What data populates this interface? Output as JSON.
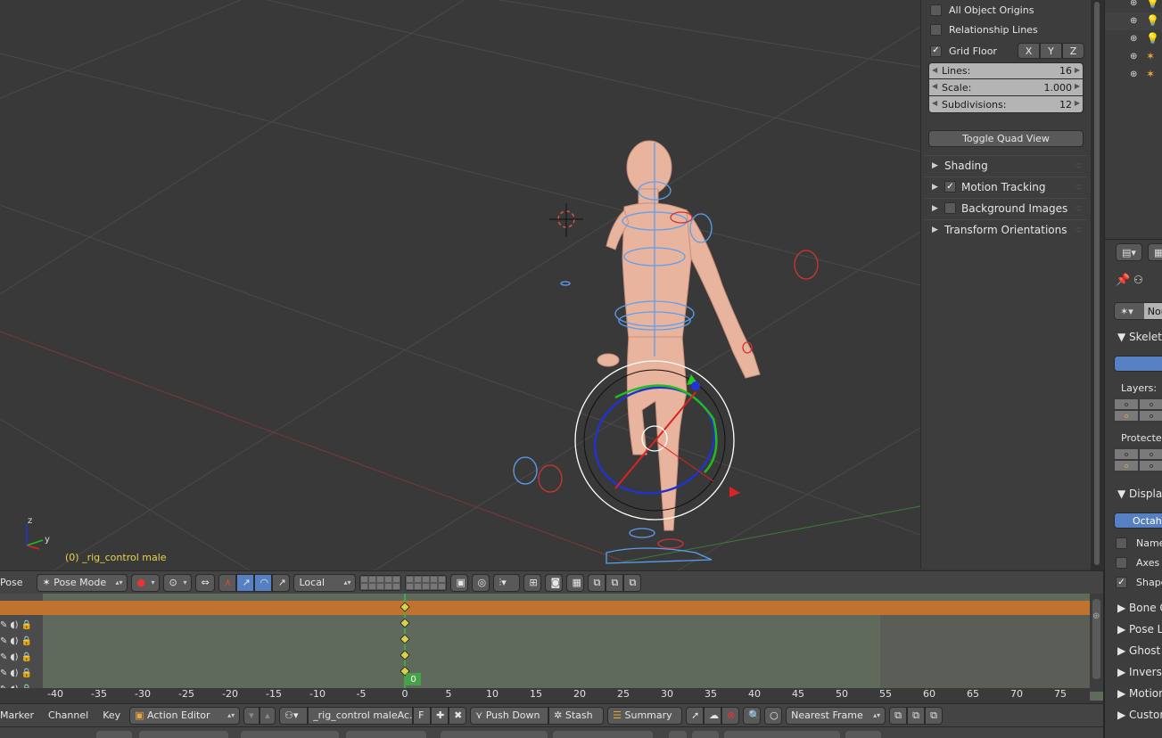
{
  "viewport": {
    "object_label": "(0) _rig_control male",
    "axis_labels": {
      "z": "z",
      "y": "y"
    }
  },
  "npanel": {
    "all_object_origins": {
      "label": "All Object Origins",
      "checked": false
    },
    "relationship_lines": {
      "label": "Relationship Lines",
      "checked": false
    },
    "grid_floor": {
      "label": "Grid Floor",
      "checked": true
    },
    "axes": [
      "X",
      "Y",
      "Z"
    ],
    "lines": {
      "label": "Lines:",
      "value": "16"
    },
    "scale": {
      "label": "Scale:",
      "value": "1.000"
    },
    "subdivisions": {
      "label": "Subdivisions:",
      "value": "12"
    },
    "toggle_quad_view": "Toggle Quad View",
    "sections": {
      "shading": "Shading",
      "motion_tracking": "Motion Tracking",
      "background_images": "Background Images",
      "transform_orientations": "Transform Orientations"
    }
  },
  "properties": {
    "armature_name": "Nor",
    "skeleton": "Skeleto",
    "layers": "Layers:",
    "protected": "Protected",
    "display": "Display",
    "octahedral": "Octahe",
    "names": "Name",
    "axes": "Axes",
    "shapes": "Shape",
    "bone_groups": "Bone G",
    "pose_library": "Pose Li",
    "ghost": "Ghost",
    "inverse": "Inverse",
    "motion": "Motion",
    "custom": "Custon"
  },
  "view3d_header": {
    "pose_menu": "Pose",
    "mode": "Pose Mode",
    "orientation": "Local"
  },
  "dopesheet": {
    "current_frame": "0",
    "ruler_ticks": [
      "-40",
      "-35",
      "-30",
      "-25",
      "-20",
      "-15",
      "-10",
      "-5",
      "0",
      "5",
      "10",
      "15",
      "20",
      "25",
      "30",
      "35",
      "40",
      "45",
      "50",
      "55",
      "60",
      "65",
      "70",
      "75"
    ]
  },
  "dope_header": {
    "marker": "Marker",
    "channel": "Channel",
    "key": "Key",
    "editor_mode": "Action Editor",
    "action_name": "_rig_control maleAc...",
    "fake_user": "F",
    "push_down": "Push Down",
    "stash": "Stash",
    "summary": "Summary",
    "snap": "Nearest Frame"
  },
  "colors": {
    "viewport_bg": "#393939",
    "summary_orange": "#c0722f",
    "keyframe_yellow": "#d9d14a",
    "frame_green": "#46a34a",
    "blue_button": "#5680c2"
  }
}
